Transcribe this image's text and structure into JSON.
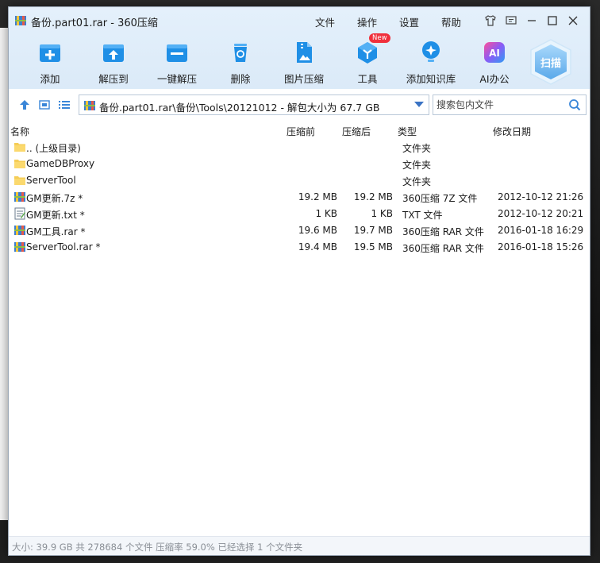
{
  "window": {
    "title": "备份.part01.rar - 360压缩"
  },
  "menu": [
    "文件",
    "操作",
    "设置",
    "帮助"
  ],
  "toolbar": {
    "tools": [
      {
        "label": "添加",
        "icon": "add-icon"
      },
      {
        "label": "解压到",
        "icon": "extract-to-icon"
      },
      {
        "label": "一键解压",
        "icon": "one-click-extract-icon"
      },
      {
        "label": "删除",
        "icon": "trash-icon"
      },
      {
        "label": "图片压缩",
        "icon": "image-compress-icon"
      },
      {
        "label": "工具",
        "icon": "tools-icon",
        "badge": "New"
      },
      {
        "label": "添加知识库",
        "icon": "knowledge-base-icon"
      },
      {
        "label": "AI办公",
        "icon": "ai-office-icon"
      }
    ],
    "scan_label": "扫描"
  },
  "address": {
    "path": "备份.part01.rar\\备份\\Tools\\20121012 - 解包大小为 67.7 GB",
    "search_placeholder": "搜索包内文件"
  },
  "columns": {
    "name": "名称",
    "packed": "压缩前",
    "compressed": "压缩后",
    "type": "类型",
    "modified": "修改日期"
  },
  "rows": [
    {
      "name": ".. (上级目录)",
      "packed": "",
      "compressed": "",
      "type": "文件夹",
      "modified": "",
      "icon": "folder-icon"
    },
    {
      "name": "GameDBProxy",
      "packed": "",
      "compressed": "",
      "type": "文件夹",
      "modified": "",
      "icon": "folder-icon"
    },
    {
      "name": "ServerTool",
      "packed": "",
      "compressed": "",
      "type": "文件夹",
      "modified": "",
      "icon": "folder-icon"
    },
    {
      "name": "GM更新.7z *",
      "packed": "19.2 MB",
      "compressed": "19.2 MB",
      "type": "360压缩 7Z 文件",
      "modified": "2012-10-12 21:26",
      "icon": "archive-icon"
    },
    {
      "name": "GM更新.txt *",
      "packed": "1 KB",
      "compressed": "1 KB",
      "type": "TXT 文件",
      "modified": "2012-10-12 20:21",
      "icon": "text-file-icon"
    },
    {
      "name": "GM工具.rar *",
      "packed": "19.6 MB",
      "compressed": "19.7 MB",
      "type": "360压缩 RAR 文件",
      "modified": "2016-01-18 16:29",
      "icon": "archive-icon"
    },
    {
      "name": "ServerTool.rar *",
      "packed": "19.4 MB",
      "compressed": "19.5 MB",
      "type": "360压缩 RAR 文件",
      "modified": "2016-01-18 15:26",
      "icon": "archive-icon"
    }
  ],
  "status": {
    "text": "大小: 39.9 GB 共 278684 个文件 压缩率 59.0% 已经选择 1 个文件夹"
  },
  "colors": {
    "accent": "#1f8fe6",
    "chrome_bg": "#dbeaf8",
    "badge": "#f0303c"
  }
}
